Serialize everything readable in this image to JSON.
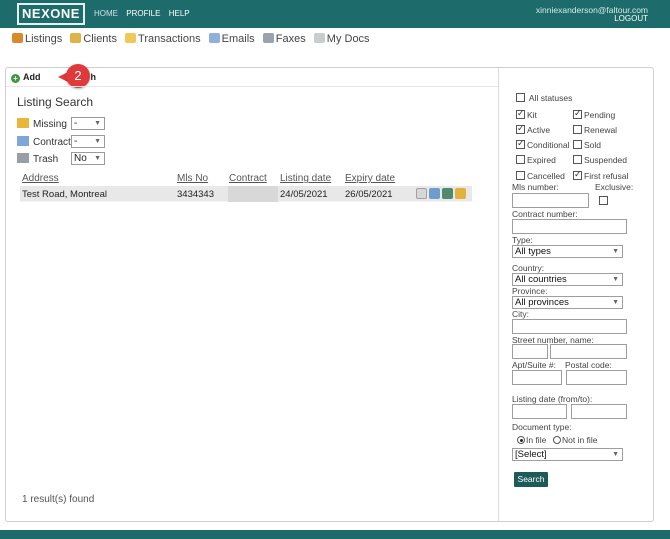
{
  "header": {
    "logo": "NEXONE",
    "nav": [
      "HOME",
      "PROFILE",
      "HELP"
    ],
    "user_email": "xinniexanderson@faltour.com",
    "logout": "LOGOUT"
  },
  "modules": [
    "Listings",
    "Clients",
    "Transactions",
    "Emails",
    "Faxes",
    "My Docs"
  ],
  "toolbar": {
    "add_label": "Add",
    "callout_number": "2",
    "partial_label": "h"
  },
  "search": {
    "title": "Listing Search",
    "filters": [
      {
        "label": "Missing",
        "value": "-"
      },
      {
        "label": "Contract",
        "value": "-"
      },
      {
        "label": "Trash",
        "value": "No"
      }
    ]
  },
  "table": {
    "columns": [
      "Address",
      "Mls No",
      "Contract",
      "Listing date",
      "Expiry date"
    ],
    "rows": [
      {
        "address": "Test Road, Montreal",
        "mls": "3434343",
        "contract": "",
        "listing_date": "24/05/2021",
        "expiry_date": "26/05/2021"
      }
    ]
  },
  "results_text": "1 result(s) found",
  "side": {
    "all_statuses": "All statuses",
    "statuses": [
      {
        "label": "Kit",
        "checked": true
      },
      {
        "label": "Pending",
        "checked": true
      },
      {
        "label": "Active",
        "checked": true
      },
      {
        "label": "Renewal",
        "checked": false
      },
      {
        "label": "Conditional",
        "checked": true
      },
      {
        "label": "Sold",
        "checked": false
      },
      {
        "label": "Expired",
        "checked": false
      },
      {
        "label": "Suspended",
        "checked": false
      },
      {
        "label": "Cancelled",
        "checked": false
      },
      {
        "label": "First refusal",
        "checked": true
      }
    ],
    "mls_number_label": "Mls number:",
    "exclusive_label": "Exclusive:",
    "contract_number_label": "Contract number:",
    "type_label": "Type:",
    "type_value": "All types",
    "country_label": "Country:",
    "country_value": "All countries",
    "province_label": "Province:",
    "province_value": "All provinces",
    "city_label": "City:",
    "street_label": "Street number, name:",
    "apt_label": "Apt/Suite #:",
    "postal_label": "Postal code:",
    "listing_date_label": "Listing date (from/to):",
    "doc_type_label": "Document type:",
    "in_file": "In file",
    "not_in_file": "Not in file",
    "doc_select_value": "[Select]",
    "search_button": "Search"
  },
  "colors": {
    "header": "#1d6b6b",
    "button": "#1d5a5a",
    "callout": "#e0393b"
  }
}
